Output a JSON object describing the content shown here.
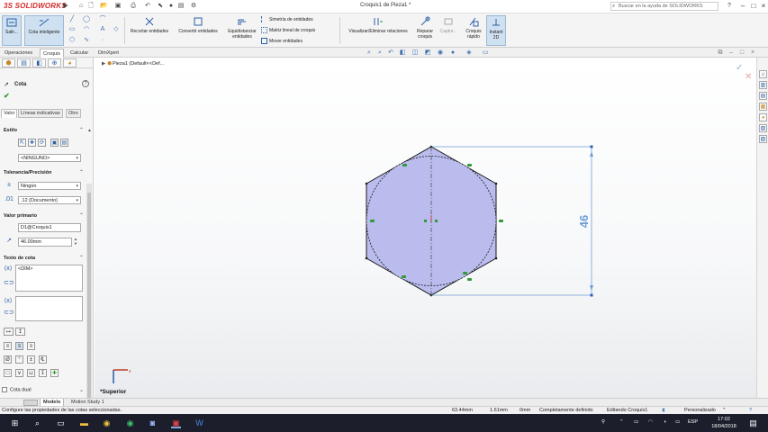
{
  "app": {
    "logo_ds": "3S",
    "logo_name": "SOLIDWORKS",
    "document_title": "Croquis1 de Pieza1 *",
    "help_search_placeholder": "Buscar en la ayuda de SOLIDWORKS",
    "help_icon": "?"
  },
  "command_manager": {
    "exit_sketch": "Salir...",
    "smart_dimension": "Cota inteligente",
    "trim": "Recortar entidades",
    "convert": "Convertir entidades",
    "offset": "Equidistanciar entidades",
    "mirror": "Simetría de entidades",
    "linear_pattern": "Matriz lineal de croquis",
    "move": "Mover entidades",
    "display_delete_relations": "Visualizar/Eliminar relaciones",
    "repair_sketch": "Reparar croquis",
    "capture": "Captur...",
    "rapid_sketch": "Croquis rápido",
    "instant2d": "Instant 2D"
  },
  "tabs": [
    "Operaciones",
    "Croquis",
    "Calcular",
    "DimXpert"
  ],
  "active_tab": "Croquis",
  "property_manager": {
    "title": "Cota",
    "subtabs": [
      "Valor",
      "Líneas indicativas",
      "Otro"
    ],
    "style": {
      "title": "Estilo",
      "value": "<NINGUNO>"
    },
    "tolerance": {
      "title": "Tolerancia/Precisión",
      "tolerance_value": "Ningún",
      "precision_value": ".12 (Documento)"
    },
    "primary_value": {
      "title": "Valor primario",
      "name": "D1@Croquis1",
      "value": "46.00mm"
    },
    "dimension_text": {
      "title": "Texto de cota",
      "text": "<DIM>"
    },
    "dual_dimension": "Cota dual"
  },
  "canvas": {
    "breadcrumb": "Pieza1 (Default<<Def...",
    "dimension_value": "46",
    "view_label": "*Superior"
  },
  "bottom_tabs": [
    "Modelo",
    "Motion Study 1"
  ],
  "status_bar": {
    "message": "Configure las propiedades de las cotas seleccionadas.",
    "x": "63.44mm",
    "y": "1.61mm",
    "z": "0mm",
    "state": "Completamente definido",
    "editing": "Editando Croquis1",
    "units": "Personalizado"
  },
  "taskbar": {
    "language": "ESP",
    "time": "17:02",
    "date": "18/04/2018"
  },
  "colors": {
    "hexagon_fill": "#b9bcec",
    "sketch_line": "#1a1a1a",
    "dimension": "#6e9ed6",
    "relation": "#2f9a3a",
    "brand_red": "#d32a2a",
    "taskbar": "#1c1f2b"
  }
}
